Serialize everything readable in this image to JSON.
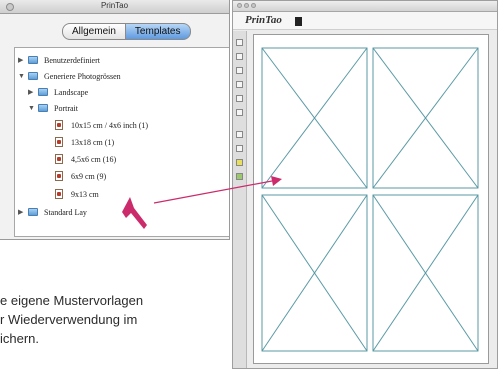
{
  "left_window": {
    "title": "PrinTao",
    "tabs": [
      {
        "label": "Allgemein"
      },
      {
        "label": "Templates"
      }
    ],
    "tree": [
      {
        "label": "Benutzerdefiniert"
      },
      {
        "label": "Generiere Photogrössen"
      },
      {
        "label": "Landscape"
      },
      {
        "label": "Portrait"
      },
      {
        "label": "10x15 cm / 4x6 inch (1)"
      },
      {
        "label": "13x18 cm (1)"
      },
      {
        "label": "4,5x6 cm (16)"
      },
      {
        "label": "6x9 cm (9)"
      },
      {
        "label": "9x13 cm"
      },
      {
        "label": "Standard Lay"
      }
    ]
  },
  "caption": {
    "line1": "e eigene Mustervorlagen",
    "line2": "r Wiederverwendung im",
    "line3": "ichern."
  },
  "doc_window": {
    "brand": "PrinTao",
    "template_slots": 4
  },
  "colors": {
    "arrow": "#cc2b6b",
    "slot_border": "#5a9aa6",
    "tab_active": "#5f9ae0"
  }
}
